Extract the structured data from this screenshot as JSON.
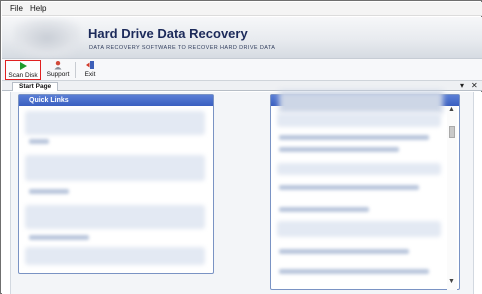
{
  "menu": {
    "file": "File",
    "help": "Help"
  },
  "banner": {
    "title": "Hard Drive Data Recovery",
    "subtitle": "DATA RECOVERY SOFTWARE TO RECOVER HARD DRIVE DATA"
  },
  "toolbar": {
    "scan_disk": "Scan Disk",
    "support": "Support",
    "exit": "Exit"
  },
  "tabs": {
    "start_page": "Start Page",
    "menu_glyph": "▾",
    "close_glyph": "✕"
  },
  "quick_links": {
    "title": "Quick Links"
  },
  "scroll": {
    "up": "▲",
    "down": "▼"
  },
  "colors": {
    "accent": "#3a5fc0",
    "scan_highlight": "#e02020",
    "title": "#1c2a5a"
  },
  "icons": {
    "scan_disk": "play-triangle-icon",
    "support": "support-person-icon",
    "exit": "exit-door-icon"
  }
}
